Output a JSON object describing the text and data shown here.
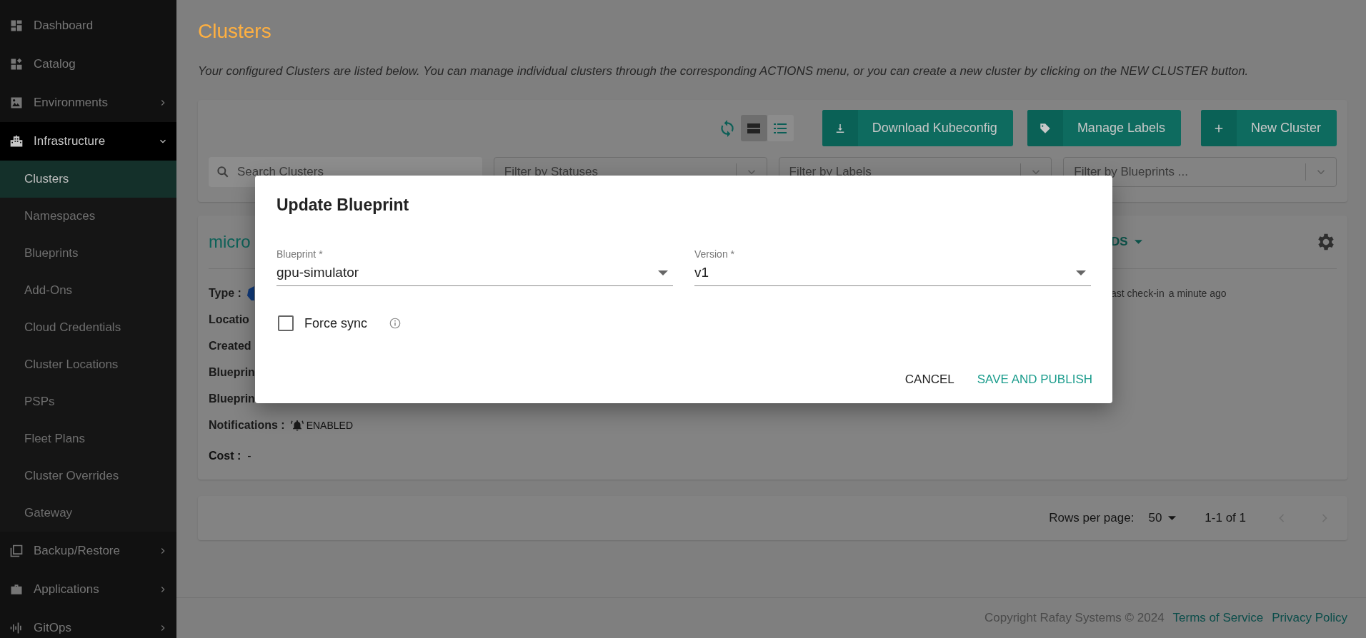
{
  "sidebar": {
    "items": [
      {
        "kind": "link",
        "label": "Dashboard",
        "selected": false
      },
      {
        "kind": "link",
        "label": "Catalog",
        "selected": false
      },
      {
        "kind": "group",
        "label": "Environments",
        "selected": false,
        "expanded": false
      },
      {
        "kind": "group",
        "label": "Infrastructure",
        "selected": true,
        "expanded": true,
        "children": [
          {
            "label": "Clusters",
            "selected": true
          },
          {
            "label": "Namespaces",
            "selected": false
          },
          {
            "label": "Blueprints",
            "selected": false
          },
          {
            "label": "Add-Ons",
            "selected": false
          },
          {
            "label": "Cloud Credentials",
            "selected": false
          },
          {
            "label": "Cluster Locations",
            "selected": false
          },
          {
            "label": "PSPs",
            "selected": false
          },
          {
            "label": "Fleet Plans",
            "selected": false
          },
          {
            "label": "Cluster Overrides",
            "selected": false
          },
          {
            "label": "Gateway",
            "selected": false
          }
        ]
      },
      {
        "kind": "group",
        "label": "Backup/Restore",
        "selected": false,
        "expanded": false
      },
      {
        "kind": "group",
        "label": "Applications",
        "selected": false,
        "expanded": false
      },
      {
        "kind": "group",
        "label": "GitOps",
        "selected": false,
        "expanded": false
      }
    ]
  },
  "page": {
    "title": "Clusters",
    "description": "Your configured Clusters are listed below. You can manage individual clusters through the corresponding ACTIONS menu, or you can create a new cluster by clicking on the NEW CLUSTER button."
  },
  "toolbar": {
    "view_modes": [
      {
        "kind": "cards",
        "selected": true
      },
      {
        "kind": "list",
        "selected": false
      }
    ],
    "buttons": [
      {
        "kind": "download",
        "label": "Download Kubeconfig"
      },
      {
        "kind": "tag",
        "label": "Manage Labels"
      },
      {
        "kind": "add",
        "label": "New Cluster"
      }
    ],
    "filters": [
      {
        "kind": "search",
        "placeholder": "Search Clusters"
      },
      {
        "kind": "select",
        "placeholder": "Filter by Statuses"
      },
      {
        "kind": "select",
        "placeholder": "Filter by Labels"
      },
      {
        "kind": "select",
        "placeholder": "Filter by Blueprints ..."
      }
    ]
  },
  "cluster_card": {
    "name": "micro",
    "menu_label": "DS",
    "fields": [
      {
        "kind": "type",
        "label": "Type :"
      },
      {
        "kind": "plain",
        "label": "Locatio"
      },
      {
        "kind": "plain",
        "label": "Created"
      },
      {
        "kind": "plain",
        "label": "Blueprin"
      },
      {
        "kind": "plain",
        "label": "Blueprin"
      },
      {
        "kind": "notifications",
        "label": "Notifications :",
        "value": "ENABLED"
      },
      {
        "kind": "inline",
        "text": "**Cost :**  -"
      }
    ],
    "checkin": {
      "label": "ast check-in",
      "value": "a minute ago"
    }
  },
  "pagination": {
    "rows_label": "Rows per page:",
    "rows_value": "50",
    "range": "1-1 of 1"
  },
  "footer": {
    "copyright": "Copyright Rafay Systems © 2024",
    "links": [
      "Terms of Service",
      "Privacy Policy"
    ]
  },
  "dialog": {
    "title": "Update Blueprint",
    "fields": [
      {
        "label": "Blueprint *",
        "value": "gpu-simulator"
      },
      {
        "label": "Version *",
        "value": "v1"
      }
    ],
    "force_sync": {
      "label": "Force sync",
      "checked": false
    },
    "buttons": [
      {
        "kind": "secondary",
        "label": "CANCEL"
      },
      {
        "kind": "primary",
        "label": "SAVE AND PUBLISH"
      }
    ]
  }
}
